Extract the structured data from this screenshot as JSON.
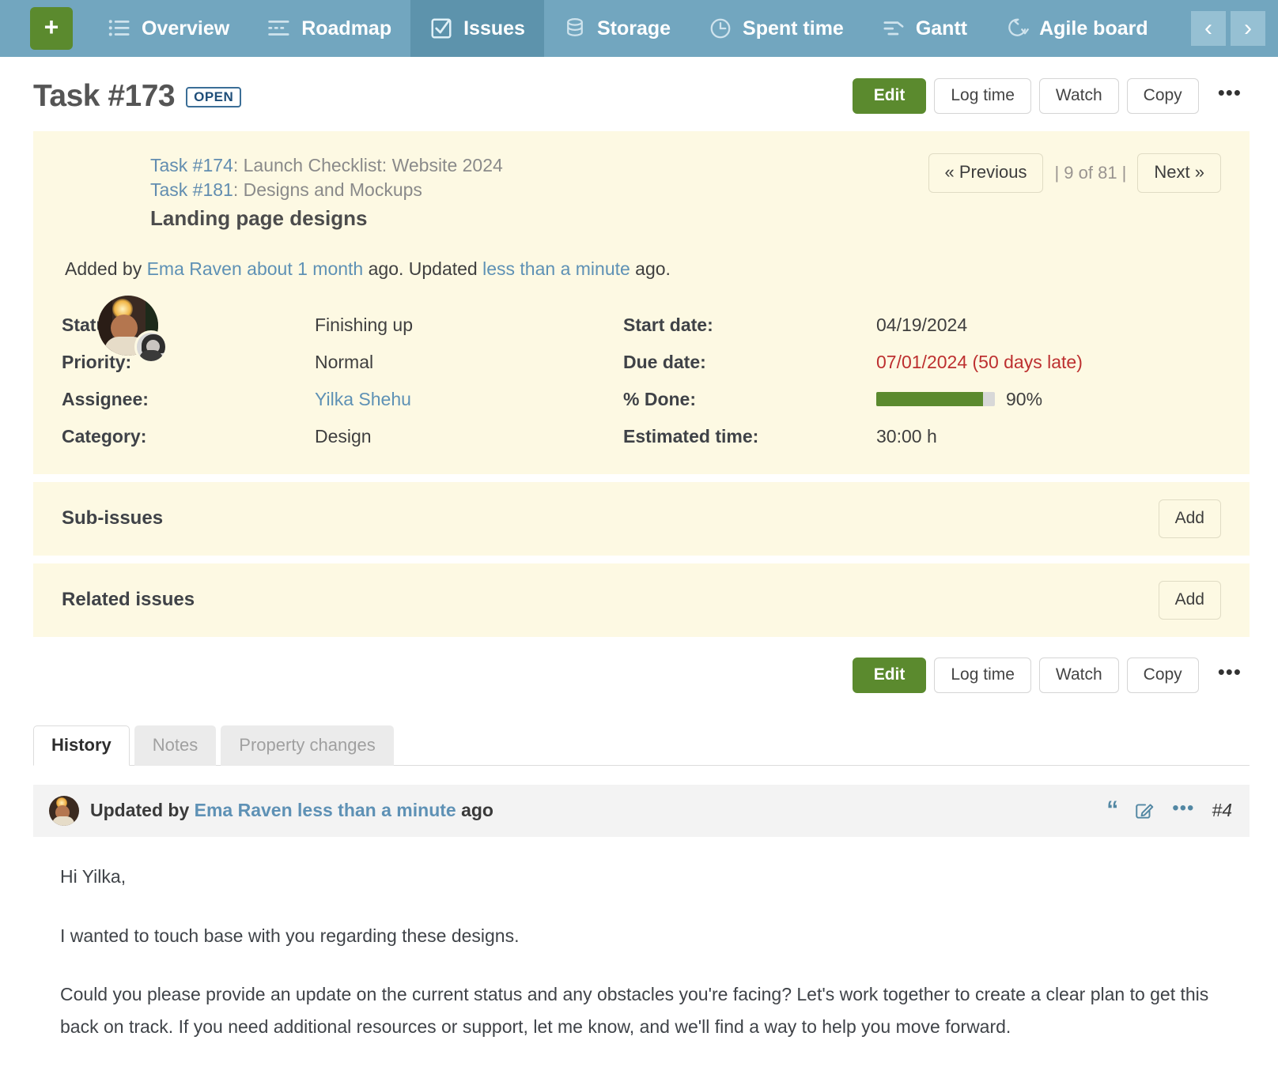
{
  "nav": {
    "add_label": "+",
    "items": [
      {
        "label": "Overview",
        "icon": "list-icon",
        "active": false
      },
      {
        "label": "Roadmap",
        "icon": "roadmap-icon",
        "active": false
      },
      {
        "label": "Issues",
        "icon": "checklist-icon",
        "active": true
      },
      {
        "label": "Storage",
        "icon": "database-icon",
        "active": false
      },
      {
        "label": "Spent time",
        "icon": "clock-icon",
        "active": false
      },
      {
        "label": "Gantt",
        "icon": "gantt-icon",
        "active": false
      },
      {
        "label": "Agile board",
        "icon": "agile-icon",
        "active": false
      }
    ],
    "prev_arrow": "‹",
    "next_arrow": "›"
  },
  "header": {
    "title": "Task #173",
    "status_badge": "OPEN"
  },
  "toolbar": {
    "edit_label": "Edit",
    "log_time_label": "Log time",
    "watch_label": "Watch",
    "copy_label": "Copy",
    "more_label": "•••"
  },
  "issue": {
    "parent_links": [
      {
        "id": "Task #174",
        "sep": ": ",
        "title": "Launch Checklist: Website 2024"
      },
      {
        "id": "Task #181",
        "sep": ": ",
        "title": "Designs and Mockups"
      }
    ],
    "subject": "Landing page designs",
    "added_prefix": "Added by ",
    "added_author": "Ema Raven",
    "added_when": " about 1 month",
    "added_mid": " ago. Updated ",
    "updated_when": "less than a minute",
    "added_suffix": " ago.",
    "pager": {
      "previous": "« Previous",
      "count": "| 9 of 81 |",
      "next": "Next »"
    },
    "attributes": {
      "status_label": "Status:",
      "status_value": "Finishing up",
      "priority_label": "Priority:",
      "priority_value": "Normal",
      "assignee_label": "Assignee:",
      "assignee_value": "Yilka Shehu",
      "category_label": "Category:",
      "category_value": "Design",
      "start_date_label": "Start date:",
      "start_date_value": "04/19/2024",
      "due_date_label": "Due date:",
      "due_date_value": "07/01/2024 (50 days late)",
      "done_label": "% Done:",
      "done_percent": 90,
      "done_value": "90%",
      "estimated_label": "Estimated time:",
      "estimated_value": "30:00 h"
    }
  },
  "sections": {
    "sub_issues_title": "Sub-issues",
    "sub_issues_add": "Add",
    "related_issues_title": "Related issues",
    "related_issues_add": "Add"
  },
  "tabs": [
    {
      "label": "History",
      "active": true
    },
    {
      "label": "Notes",
      "active": false
    },
    {
      "label": "Property changes",
      "active": false
    }
  ],
  "history": {
    "prefix": "Updated by ",
    "author": "Ema Raven",
    "when": " less than a minute",
    "suffix": " ago",
    "quote_icon": "“",
    "edit_icon": "edit-icon",
    "more_icon": "•••",
    "number": "#4",
    "paragraphs": [
      "Hi Yilka,",
      "I wanted to touch base with you regarding these designs.",
      "Could you please provide an update on the current status and any obstacles you're facing? Let's work together to create a clear plan to get this back on track. If you need additional resources or support, let me know, and we'll find a way to help you move forward."
    ]
  },
  "colors": {
    "nav_bg": "#72a6bf",
    "nav_active": "#5d93ac",
    "accent_green": "#5b8a2e",
    "card_bg": "#fdf9e3",
    "link_blue": "#5e91b5",
    "late_red": "#bd3030"
  }
}
